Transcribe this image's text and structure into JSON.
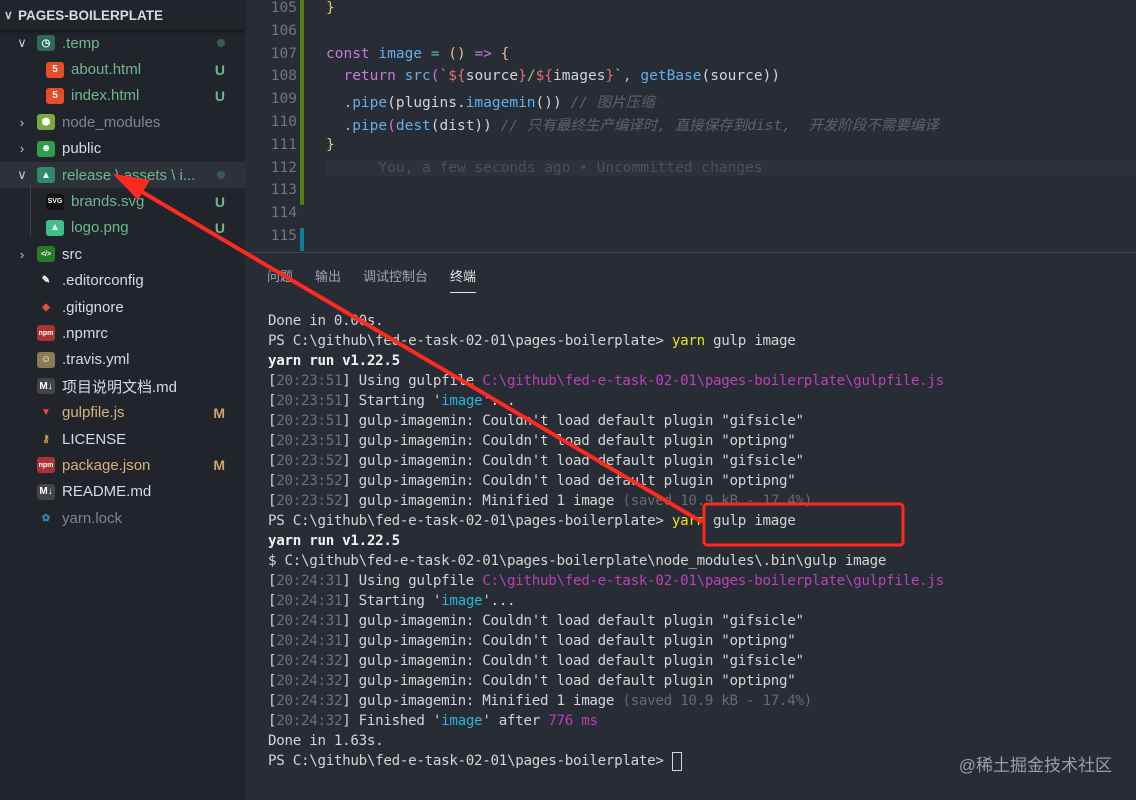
{
  "explorer": {
    "title": "PAGES-BOILERPLATE",
    "items": [
      {
        "label": ".temp",
        "icon": "folder-temp-icon",
        "glyph": "◷",
        "color": "#6db88e",
        "icbg": "#2f6b5a",
        "chev": "v",
        "level": 1,
        "dot": true
      },
      {
        "label": "about.html",
        "icon": "html5-icon",
        "glyph": "5",
        "color": "#6db88e",
        "icbg": "#e44d26",
        "level": 2,
        "badge": "U",
        "badgeColor": "#6db88e"
      },
      {
        "label": "index.html",
        "icon": "html5-icon",
        "glyph": "5",
        "color": "#6db88e",
        "icbg": "#e44d26",
        "level": 2,
        "badge": "U",
        "badgeColor": "#6db88e"
      },
      {
        "label": "node_modules",
        "icon": "folder-node-icon",
        "glyph": "⬢",
        "color": "#7f848e",
        "icbg": "#7aa83a",
        "chev": ">",
        "level": 1
      },
      {
        "label": "public",
        "icon": "folder-public-icon",
        "glyph": "☻",
        "color": "#d7dae0",
        "icbg": "#2e9e4a",
        "chev": ">",
        "level": 1
      },
      {
        "label": "release \\ assets \\ i...",
        "icon": "folder-images-icon",
        "glyph": "▲",
        "color": "#6db88e",
        "icbg": "#2f8a6a",
        "chev": "v",
        "level": 1,
        "dot": true,
        "selected": true
      },
      {
        "label": "brands.svg",
        "icon": "svg-icon",
        "glyph": "SVG",
        "color": "#6db88e",
        "icbg": "#111",
        "level": 2,
        "badge": "U",
        "badgeColor": "#6db88e"
      },
      {
        "label": "logo.png",
        "icon": "image-icon",
        "glyph": "▲",
        "color": "#6db88e",
        "icbg": "#3dbf8a",
        "level": 2,
        "badge": "U",
        "badgeColor": "#6db88e"
      },
      {
        "label": "src",
        "icon": "folder-src-icon",
        "glyph": "</>",
        "color": "#d7dae0",
        "icbg": "#2b7a2b",
        "chev": ">",
        "level": 1
      },
      {
        "label": ".editorconfig",
        "icon": "editorconfig-icon",
        "glyph": "✎",
        "color": "#d7dae0",
        "icbg": "transparent",
        "level": 1
      },
      {
        "label": ".gitignore",
        "icon": "git-icon",
        "glyph": "◆",
        "color": "#d7dae0",
        "icbg": "transparent",
        "level": 1,
        "glyphColor": "#e0533f"
      },
      {
        "label": ".npmrc",
        "icon": "npm-icon",
        "glyph": "npm",
        "color": "#d7dae0",
        "icbg": "#a33",
        "level": 1
      },
      {
        "label": ".travis.yml",
        "icon": "travis-icon",
        "glyph": "☺",
        "color": "#d7dae0",
        "icbg": "#8a7a55",
        "level": 1
      },
      {
        "label": "项目说明文档.md",
        "icon": "markdown-icon",
        "glyph": "M↓",
        "color": "#d7dae0",
        "icbg": "#444",
        "level": 1
      },
      {
        "label": "gulpfile.js",
        "icon": "gulp-icon",
        "glyph": "▼",
        "color": "#d8b07a",
        "icbg": "transparent",
        "level": 1,
        "glyphColor": "#e8494e",
        "badge": "M",
        "badgeColor": "#c9a66b"
      },
      {
        "label": "LICENSE",
        "icon": "license-icon",
        "glyph": "⚷",
        "color": "#d7dae0",
        "icbg": "transparent",
        "level": 1,
        "glyphColor": "#e0b33a"
      },
      {
        "label": "package.json",
        "icon": "npm-icon",
        "glyph": "npm",
        "color": "#d8b07a",
        "icbg": "#a33",
        "level": 1,
        "badge": "M",
        "badgeColor": "#c9a66b"
      },
      {
        "label": "README.md",
        "icon": "markdown-icon",
        "glyph": "M↓",
        "color": "#d7dae0",
        "icbg": "#444",
        "level": 1
      },
      {
        "label": "yarn.lock",
        "icon": "yarn-icon",
        "glyph": "✿",
        "color": "#7f848e",
        "icbg": "transparent",
        "level": 1,
        "glyphColor": "#2c8ebb"
      }
    ]
  },
  "editor": {
    "lines": [
      {
        "n": "105",
        "segs": [
          {
            "t": "}",
            "c": "#e5c07b"
          }
        ]
      },
      {
        "n": "106",
        "segs": []
      },
      {
        "n": "107",
        "segs": [
          {
            "t": "const ",
            "c": "#c678dd"
          },
          {
            "t": "image",
            "c": "#61afef"
          },
          {
            "t": " = ",
            "c": "#56b6c2"
          },
          {
            "t": "() ",
            "c": "#e5c07b"
          },
          {
            "t": "=> ",
            "c": "#c678dd"
          },
          {
            "t": "{",
            "c": "#e5c07b"
          }
        ]
      },
      {
        "n": "108",
        "segs": [
          {
            "t": "  return ",
            "c": "#c678dd"
          },
          {
            "t": "src",
            "c": "#61afef"
          },
          {
            "t": "(`",
            "c": "#c678dd"
          },
          {
            "t": "${",
            "c": "#e06c75"
          },
          {
            "t": "source",
            "c": "#d4d4d4"
          },
          {
            "t": "}",
            "c": "#e06c75"
          },
          {
            "t": "/",
            "c": "#98c379"
          },
          {
            "t": "${",
            "c": "#e06c75"
          },
          {
            "t": "images",
            "c": "#d4d4d4"
          },
          {
            "t": "}",
            "c": "#e06c75"
          },
          {
            "t": "`, ",
            "c": "#abb2bf"
          },
          {
            "t": "getBase",
            "c": "#61afef"
          },
          {
            "t": "(source))",
            "c": "#d4d4d4"
          }
        ]
      },
      {
        "n": "109",
        "segs": [
          {
            "t": "  .",
            "c": "#abb2bf"
          },
          {
            "t": "pipe",
            "c": "#61afef"
          },
          {
            "t": "(plugins.",
            "c": "#d4d4d4"
          },
          {
            "t": "imagemin",
            "c": "#61afef"
          },
          {
            "t": "()) ",
            "c": "#d4d4d4"
          },
          {
            "t": "// 图片压缩",
            "c": "#5c6370",
            "i": true
          }
        ]
      },
      {
        "n": "110",
        "segs": [
          {
            "t": "  .",
            "c": "#abb2bf"
          },
          {
            "t": "pipe",
            "c": "#61afef"
          },
          {
            "t": "(",
            "c": "#c678dd"
          },
          {
            "t": "dest",
            "c": "#61afef"
          },
          {
            "t": "(dist)) ",
            "c": "#d4d4d4"
          },
          {
            "t": "// 只有最终生产编译时, 直接保存到dist,  开发阶段不需要编译",
            "c": "#5c6370",
            "i": true
          }
        ]
      },
      {
        "n": "111",
        "segs": [
          {
            "t": "}",
            "c": "#e5c07b"
          }
        ]
      },
      {
        "n": "112",
        "segs": [
          {
            "t": "      You, a few seconds ago • Uncommitted changes",
            "c": "#4b515c"
          }
        ],
        "blame": true
      },
      {
        "n": "113",
        "segs": []
      },
      {
        "n": "114",
        "segs": []
      },
      {
        "n": "115",
        "segs": []
      }
    ]
  },
  "panel": {
    "tabs": [
      "问题",
      "输出",
      "调试控制台",
      "终端"
    ],
    "active": 3
  },
  "terminal": {
    "lines": [
      [
        [
          "Done in 0.00s.",
          "white"
        ]
      ],
      [
        [
          "PS C:\\github\\fed-e-task-02-01\\pages-boilerplate> ",
          "white"
        ],
        [
          "yarn",
          "yellow"
        ],
        [
          " gulp image",
          "white"
        ]
      ],
      [
        [
          "yarn run v1.22.5",
          "bold"
        ]
      ],
      [
        [
          "[",
          "white"
        ],
        [
          "20:23:51",
          "gray"
        ],
        [
          "] Using gulpfile ",
          "white"
        ],
        [
          "C:\\github\\fed-e-task-02-01\\pages-boilerplate\\gulpfile.js",
          "purple"
        ]
      ],
      [
        [
          "[",
          "white"
        ],
        [
          "20:23:51",
          "gray"
        ],
        [
          "] Starting '",
          "white"
        ],
        [
          "image",
          "cyan"
        ],
        [
          "'...",
          "white"
        ]
      ],
      [
        [
          "[",
          "white"
        ],
        [
          "20:23:51",
          "gray"
        ],
        [
          "] gulp-imagemin: Couldn't load default plugin \"gifsicle\"",
          "white"
        ]
      ],
      [
        [
          "[",
          "white"
        ],
        [
          "20:23:51",
          "gray"
        ],
        [
          "] gulp-imagemin: Couldn't load default plugin \"optipng\"",
          "white"
        ]
      ],
      [
        [
          "[",
          "white"
        ],
        [
          "20:23:52",
          "gray"
        ],
        [
          "] gulp-imagemin: Couldn't load default plugin \"gifsicle\"",
          "white"
        ]
      ],
      [
        [
          "[",
          "white"
        ],
        [
          "20:23:52",
          "gray"
        ],
        [
          "] gulp-imagemin: Couldn't load default plugin \"optipng\"",
          "white"
        ]
      ],
      [
        [
          "[",
          "white"
        ],
        [
          "20:23:52",
          "gray"
        ],
        [
          "] gulp-imagemin: Minified 1 image ",
          "white"
        ],
        [
          "(saved 10.9 kB - 17.4%)",
          "dim"
        ]
      ],
      [
        [
          "PS C:\\github\\fed-e-task-02-01\\pages-boilerplate> ",
          "white"
        ],
        [
          "yarn",
          "yellow"
        ],
        [
          " gulp image",
          "white"
        ]
      ],
      [
        [
          "yarn run v1.22.5",
          "bold"
        ]
      ],
      [
        [
          "$ C:\\github\\fed-e-task-02-01\\pages-boilerplate\\node_modules\\.bin\\gulp image",
          "white"
        ]
      ],
      [
        [
          "[",
          "white"
        ],
        [
          "20:24:31",
          "gray"
        ],
        [
          "] Using gulpfile ",
          "white"
        ],
        [
          "C:\\github\\fed-e-task-02-01\\pages-boilerplate\\gulpfile.js",
          "purple"
        ]
      ],
      [
        [
          "[",
          "white"
        ],
        [
          "20:24:31",
          "gray"
        ],
        [
          "] Starting '",
          "white"
        ],
        [
          "image",
          "cyan"
        ],
        [
          "'...",
          "white"
        ]
      ],
      [
        [
          "[",
          "white"
        ],
        [
          "20:24:31",
          "gray"
        ],
        [
          "] gulp-imagemin: Couldn't load default plugin \"gifsicle\"",
          "white"
        ]
      ],
      [
        [
          "[",
          "white"
        ],
        [
          "20:24:31",
          "gray"
        ],
        [
          "] gulp-imagemin: Couldn't load default plugin \"optipng\"",
          "white"
        ]
      ],
      [
        [
          "[",
          "white"
        ],
        [
          "20:24:32",
          "gray"
        ],
        [
          "] gulp-imagemin: Couldn't load default plugin \"gifsicle\"",
          "white"
        ]
      ],
      [
        [
          "[",
          "white"
        ],
        [
          "20:24:32",
          "gray"
        ],
        [
          "] gulp-imagemin: Couldn't load default plugin \"optipng\"",
          "white"
        ]
      ],
      [
        [
          "[",
          "white"
        ],
        [
          "20:24:32",
          "gray"
        ],
        [
          "] gulp-imagemin: Minified 1 image ",
          "white"
        ],
        [
          "(saved 10.9 kB - 17.4%)",
          "dim"
        ]
      ],
      [
        [
          "[",
          "white"
        ],
        [
          "20:24:32",
          "gray"
        ],
        [
          "] Finished '",
          "white"
        ],
        [
          "image",
          "cyan"
        ],
        [
          "' after ",
          "white"
        ],
        [
          "776 ms",
          "purple"
        ]
      ],
      [
        [
          "Done in 1.63s.",
          "white"
        ]
      ],
      [
        [
          "PS C:\\github\\fed-e-task-02-01\\pages-boilerplate> ",
          "white"
        ]
      ]
    ]
  },
  "watermark": "@稀土掘金技术社区",
  "annotation_color": "#ff2a1f"
}
